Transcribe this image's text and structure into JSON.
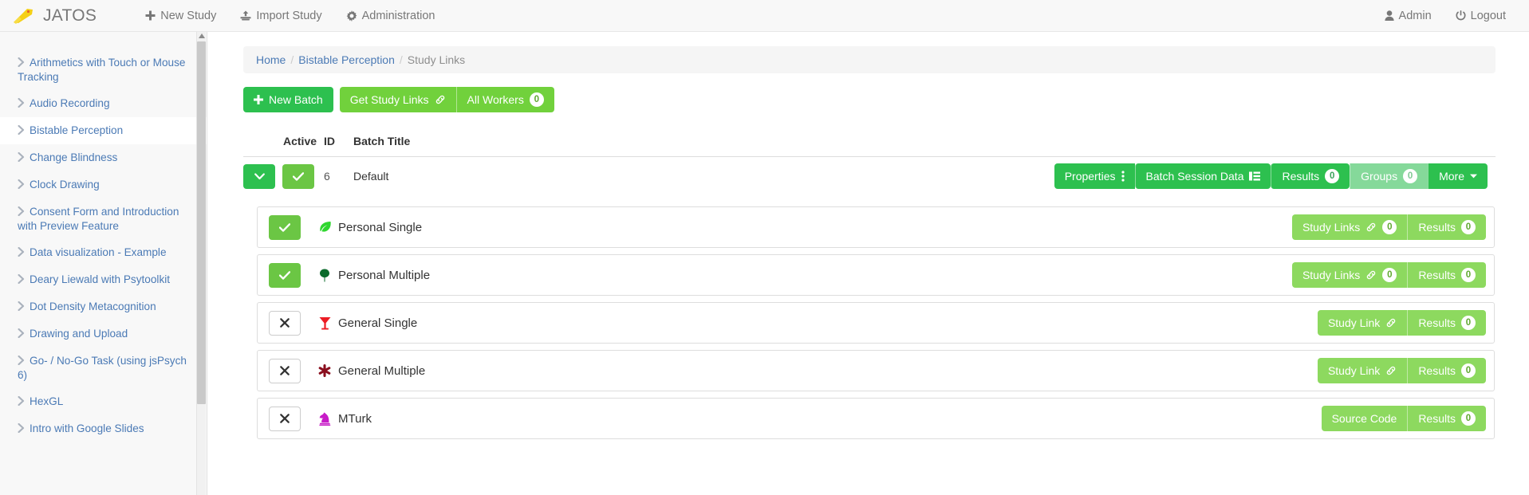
{
  "navbar": {
    "brand": "JATOS",
    "logo_icon": "jatos-rocket-logo",
    "links": [
      {
        "label": "New Study",
        "icon": "plus-icon"
      },
      {
        "label": "Import Study",
        "icon": "import-upload-icon"
      },
      {
        "label": "Administration",
        "icon": "gear-icon"
      }
    ],
    "right_links": [
      {
        "label": "Admin",
        "icon": "user-icon"
      },
      {
        "label": "Logout",
        "icon": "power-icon"
      }
    ]
  },
  "sidebar": {
    "items": [
      {
        "label": "Arithmetics with Touch or Mouse Tracking",
        "active": false
      },
      {
        "label": "Audio Recording",
        "active": false
      },
      {
        "label": "Bistable Perception",
        "active": true
      },
      {
        "label": "Change Blindness",
        "active": false
      },
      {
        "label": "Clock Drawing",
        "active": false
      },
      {
        "label": "Consent Form and Introduction with Preview Feature",
        "active": false
      },
      {
        "label": "Data visualization - Example",
        "active": false
      },
      {
        "label": "Deary Liewald with Psytoolkit",
        "active": false
      },
      {
        "label": "Dot Density Metacognition",
        "active": false
      },
      {
        "label": "Drawing and Upload",
        "active": false
      },
      {
        "label": "Go- / No-Go Task (using jsPsych 6)",
        "active": false
      },
      {
        "label": "HexGL",
        "active": false
      },
      {
        "label": "Intro with Google Slides",
        "active": false
      }
    ],
    "caret_icon": "chevron-right-icon"
  },
  "breadcrumb": {
    "home": "Home",
    "study": "Bistable Perception",
    "current": "Study Links",
    "separator": "/"
  },
  "toolbar": {
    "new_batch_label": "New Batch",
    "new_batch_icon": "plus-icon",
    "get_study_links_label": "Get Study Links",
    "get_study_links_icon": "link-icon",
    "all_workers_label": "All Workers",
    "all_workers_count": "0"
  },
  "table": {
    "headers": {
      "active": "Active",
      "id": "ID",
      "batch_title": "Batch Title"
    }
  },
  "batch": {
    "expand_icon": "chevron-down-icon",
    "active_icon": "check-icon",
    "id": "6",
    "title": "Default",
    "actions": {
      "properties_label": "Properties",
      "properties_icon": "vertical-dots-icon",
      "batch_session_label": "Batch Session Data",
      "batch_session_icon": "list-table-icon",
      "results_label": "Results",
      "results_count": "0",
      "groups_label": "Groups",
      "groups_count": "0",
      "more_label": "More",
      "more_icon": "caret-down-icon"
    }
  },
  "workers": [
    {
      "name": "Personal Single",
      "icon": "leaf-icon",
      "icon_color": "#2fd62f",
      "enabled": true,
      "toggle_icon": "check-icon",
      "primary_label": "Study Links",
      "primary_icon": "link-icon",
      "primary_count": "0",
      "results_label": "Results",
      "results_count": "0"
    },
    {
      "name": "Personal Multiple",
      "icon": "tree-icon",
      "icon_color": "#0b6b2b",
      "enabled": true,
      "toggle_icon": "check-icon",
      "primary_label": "Study Links",
      "primary_icon": "link-icon",
      "primary_count": "0",
      "results_label": "Results",
      "results_count": "0"
    },
    {
      "name": "General Single",
      "icon": "cocktail-glass-icon",
      "icon_color": "#ec1c24",
      "enabled": false,
      "toggle_icon": "close-x-icon",
      "primary_label": "Study Link",
      "primary_icon": "link-icon",
      "primary_count": null,
      "results_label": "Results",
      "results_count": "0"
    },
    {
      "name": "General Multiple",
      "icon": "asterisk-icon",
      "icon_color": "#8a0f1e",
      "enabled": false,
      "toggle_icon": "close-x-icon",
      "primary_label": "Study Link",
      "primary_icon": "link-icon",
      "primary_count": null,
      "results_label": "Results",
      "results_count": "0"
    },
    {
      "name": "MTurk",
      "icon": "chess-knight-icon",
      "icon_color": "#c71cc7",
      "enabled": false,
      "toggle_icon": "close-x-icon",
      "primary_label": "Source Code",
      "primary_icon": null,
      "primary_count": null,
      "results_label": "Results",
      "results_count": "0"
    }
  ],
  "colors": {
    "brand_yellow": "#f5d017",
    "green_dark": "#2dc04f",
    "green_light": "#71d13c",
    "link_blue": "#4b7ab5"
  }
}
